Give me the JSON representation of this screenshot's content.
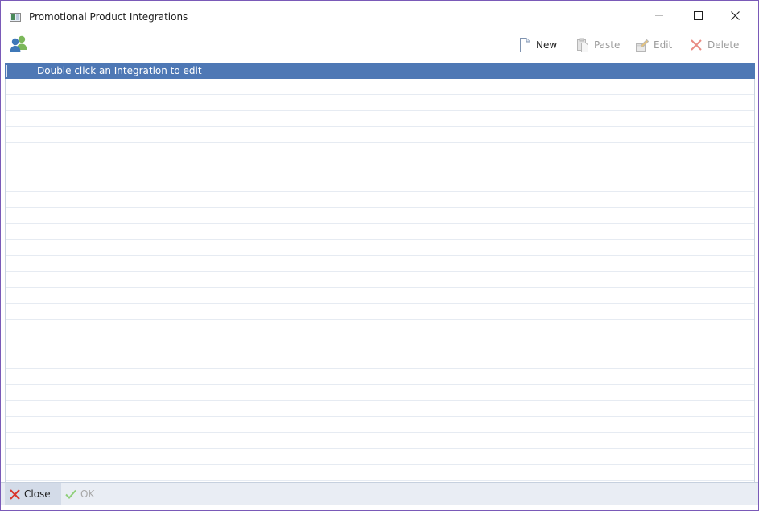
{
  "window": {
    "title": "Promotional Product Integrations"
  },
  "toolbar": {
    "new_label": "New",
    "paste_label": "Paste",
    "edit_label": "Edit",
    "delete_label": "Delete"
  },
  "grid": {
    "header_text": "Double click an Integration to edit",
    "rows": []
  },
  "footer": {
    "close_label": "Close",
    "ok_label": "OK"
  },
  "colors": {
    "header_bar": "#4e78b5",
    "window_border": "#7a5ab8",
    "delete_red": "#d9342b",
    "ok_green": "#8fcf7a"
  },
  "icons": {
    "app": "app-window-icon",
    "users": "users-icon",
    "new": "new-document-icon",
    "paste": "paste-icon",
    "edit": "edit-icon",
    "delete": "delete-x-icon",
    "close": "close-x-icon",
    "ok": "checkmark-icon"
  }
}
